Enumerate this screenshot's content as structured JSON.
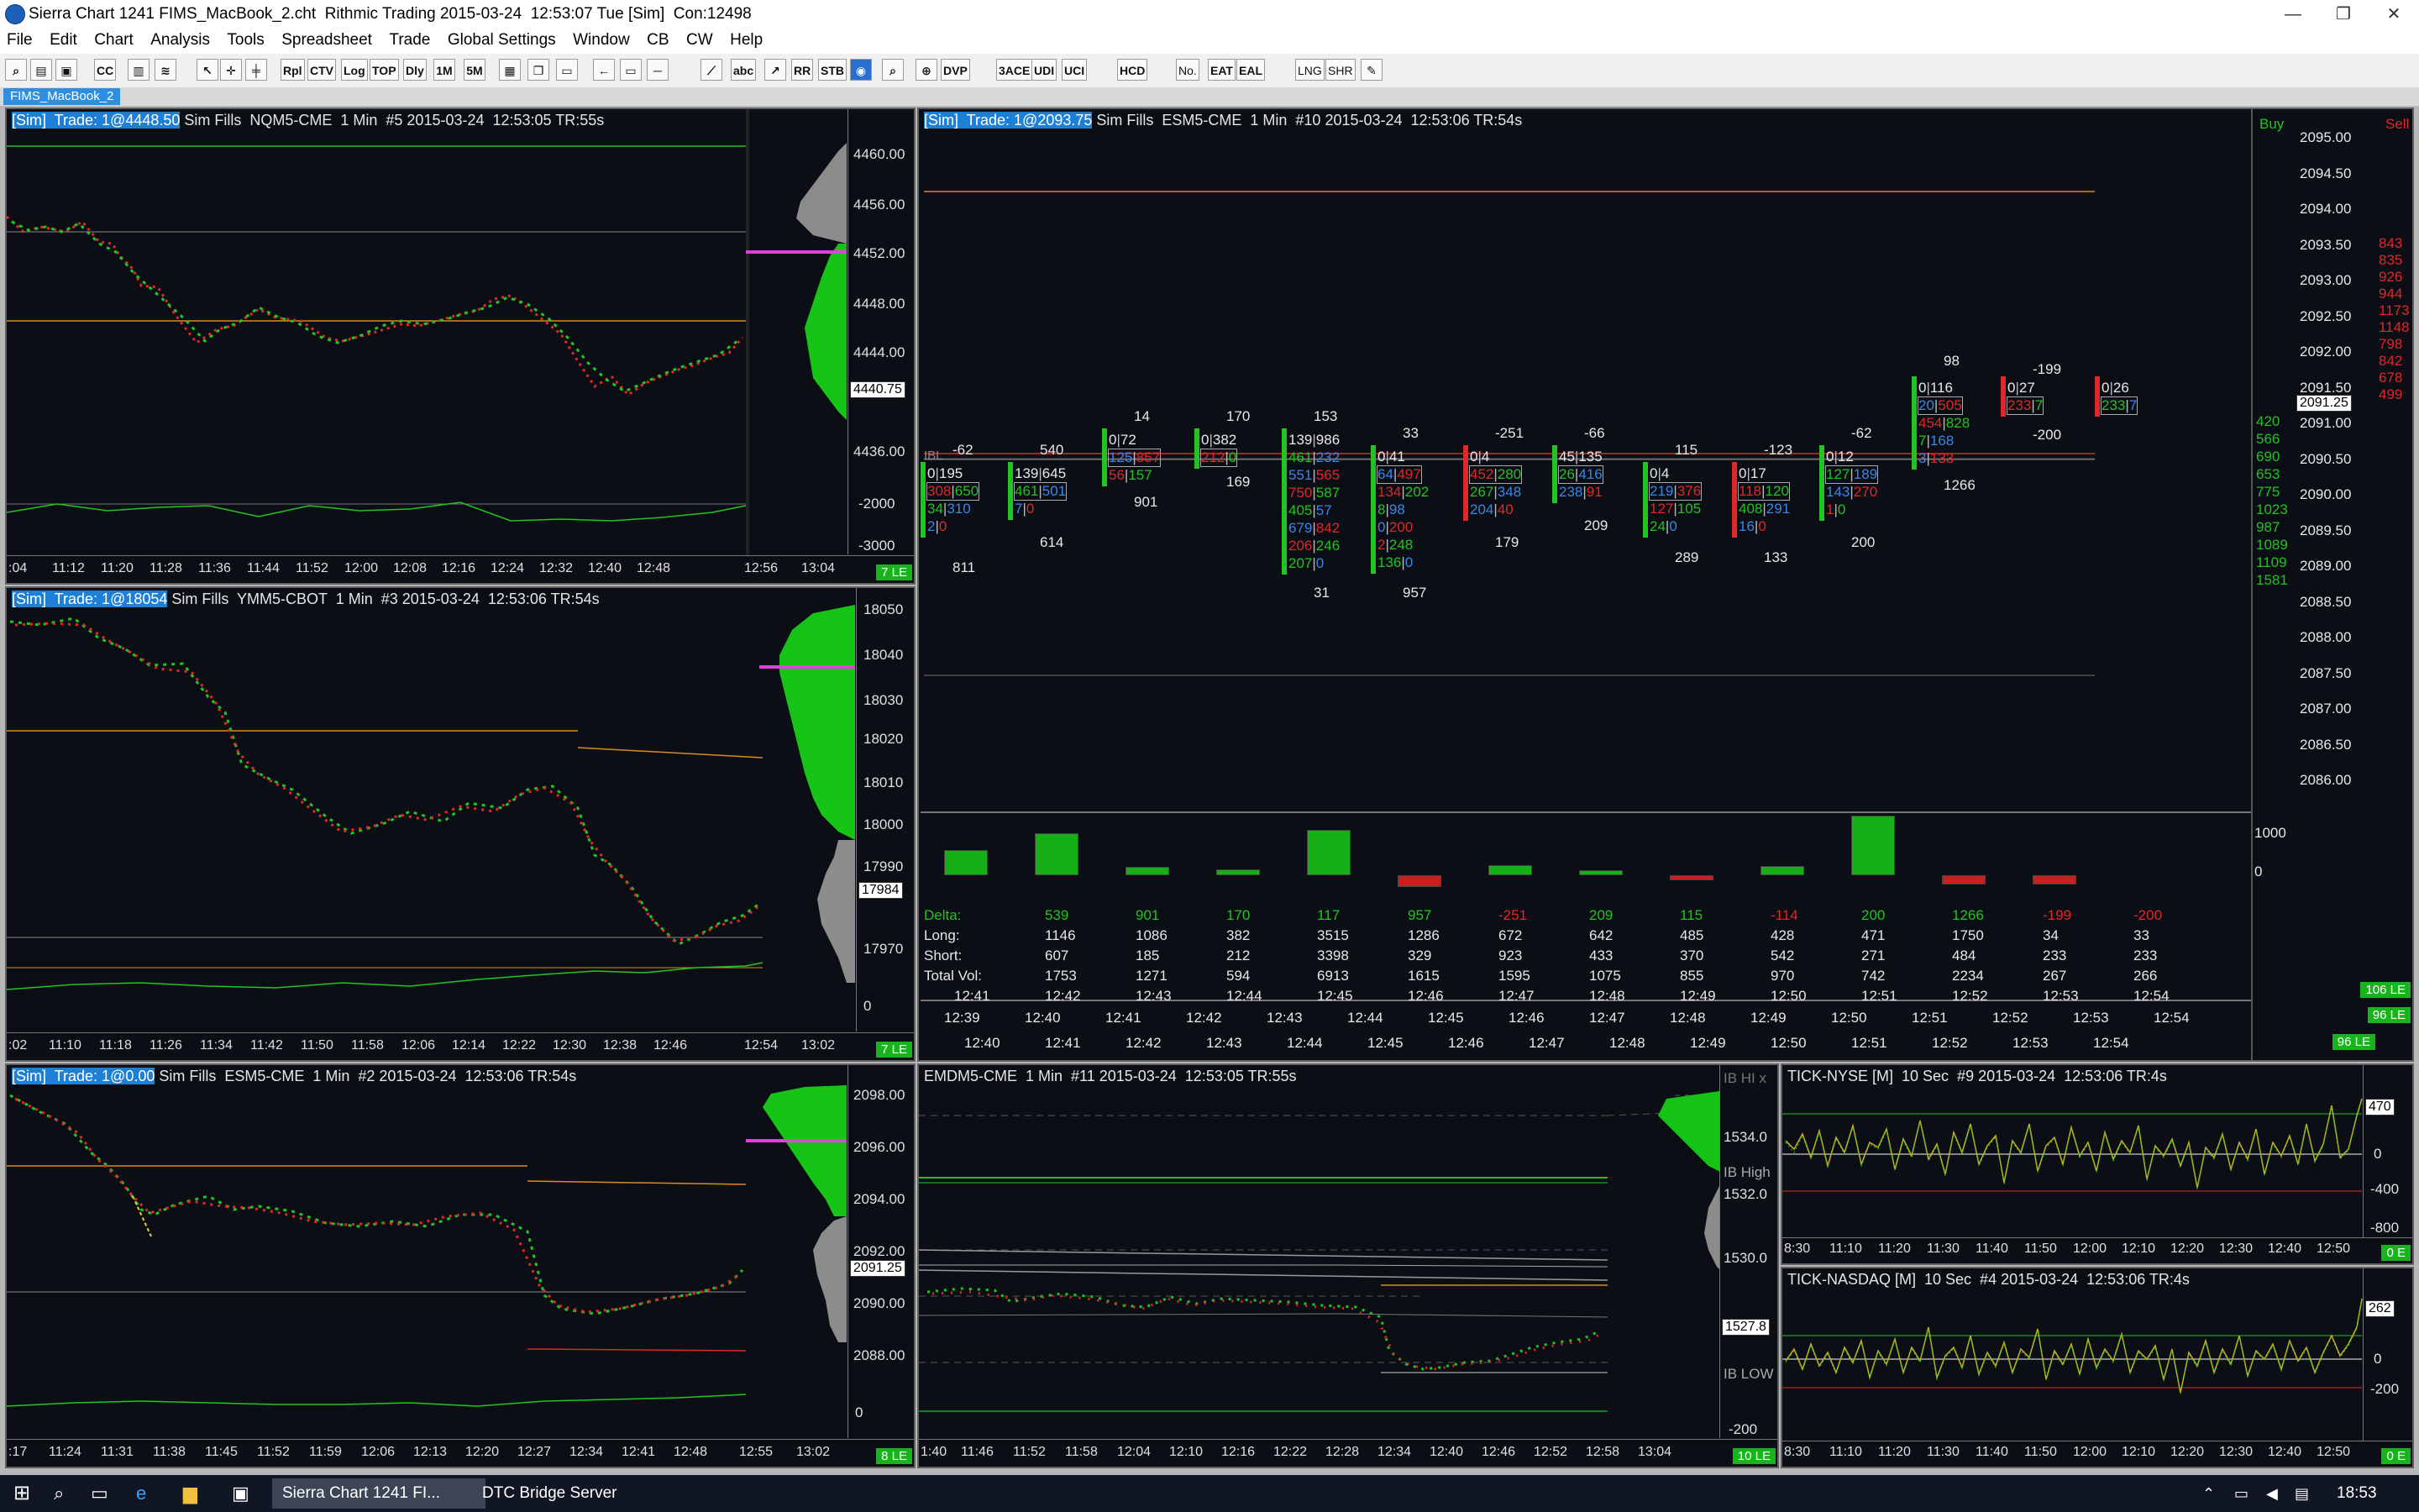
{
  "window": {
    "title": "Sierra Chart 1241 FIMS_MacBook_2.cht  Rithmic Trading 2015-03-24  12:53:07 Tue [Sim]  Con:12498",
    "minimize_glyph": "—",
    "restore_glyph": "❐",
    "close_glyph": "✕"
  },
  "menu": [
    "File",
    "Edit",
    "Chart",
    "Analysis",
    "Tools",
    "Spreadsheet",
    "Trade",
    "Global Settings",
    "Window",
    "CB",
    "CW",
    "Help"
  ],
  "toolbar": [
    "Rpl",
    "CTV",
    "Log",
    "TOP",
    "Dly",
    "1M",
    "5M",
    "DVP",
    "3ACE",
    "UDI",
    "UCI",
    "HCD",
    "No.",
    "EAT",
    "EAL",
    "LNG",
    "SHR",
    "abc",
    "RR",
    "STB",
    "CC"
  ],
  "chartbook_tab": "FIMS_MacBook_2",
  "chart_nq": {
    "title_hl": "[Sim]  Trade: 1@4448.50",
    "title": " Sim Fills  NQM5-CME  1 Min  #5 2015-03-24  12:53:05 TR:55s",
    "y_labels": [
      "4460.00",
      "4456.00",
      "4452.00",
      "4448.00",
      "4444.00",
      "4436.00",
      "-2000",
      "-3000"
    ],
    "price_box": "4440.75",
    "x_labels": [
      ":04",
      "11:12",
      "11:20",
      "11:28",
      "11:36",
      "11:44",
      "11:52",
      "12:00",
      "12:08",
      "12:16",
      "12:24",
      "12:32",
      "12:40",
      "12:48",
      "12:56",
      "13:04"
    ],
    "le": "7 LE"
  },
  "chart_ym": {
    "title_hl": "[Sim]  Trade: 1@18054",
    "title": " Sim Fills  YMM5-CBOT  1 Min  #3 2015-03-24  12:53:06 TR:54s",
    "y_labels": [
      "18050",
      "18040",
      "18030",
      "18020",
      "18010",
      "18000",
      "17990",
      "17970",
      "0"
    ],
    "price_box": "17984",
    "x_labels": [
      ":02",
      "11:10",
      "11:18",
      "11:26",
      "11:34",
      "11:42",
      "11:50",
      "11:58",
      "12:06",
      "12:14",
      "12:22",
      "12:30",
      "12:38",
      "12:46",
      "12:54",
      "13:02"
    ],
    "le": "7 LE"
  },
  "chart_es": {
    "title_hl": "[Sim]  Trade: 1@0.00",
    "title": " Sim Fills  ESM5-CME  1 Min  #2 2015-03-24  12:53:06 TR:54s",
    "y_labels": [
      "2098.00",
      "2096.00",
      "2094.00",
      "2092.00",
      "2090.00",
      "2088.00",
      "0"
    ],
    "price_box": "2091.25",
    "x_labels": [
      ":17",
      "11:24",
      "11:31",
      "11:38",
      "11:45",
      "11:52",
      "11:59",
      "12:06",
      "12:13",
      "12:20",
      "12:27",
      "12:34",
      "12:41",
      "12:48",
      "12:55",
      "13:02"
    ],
    "le": "8 LE"
  },
  "footprint": {
    "title_hl": "[Sim]  Trade: 1@2093.75",
    "title": " Sim Fills  ESM5-CME  1 Min  #10 2015-03-24  12:53:06 TR:54s",
    "buy_label": "Buy",
    "sell_label": "Sell",
    "ibl_label": "IBL",
    "y_labels": [
      "2095.00",
      "2094.50",
      "2094.00",
      "2093.50",
      "2093.00",
      "2092.50",
      "2092.00",
      "2091.50",
      "2091.00",
      "2090.50",
      "2090.00",
      "2089.50",
      "2089.00",
      "2088.50",
      "2088.00",
      "2087.50",
      "2087.00",
      "2086.50",
      "2086.00"
    ],
    "price_box": "2091.25",
    "sell_column": [
      "843",
      "835",
      "926",
      "944",
      "1173",
      "1148",
      "798",
      "842",
      "678",
      "499"
    ],
    "buy_column": [
      "420",
      "566",
      "690",
      "653",
      "775",
      "1023",
      "987",
      "1089",
      "1109",
      "1581"
    ],
    "delta_axis": [
      "1000",
      "0"
    ],
    "top_labels": [
      "-62",
      "540",
      "14",
      "170",
      "153",
      "33",
      "-251",
      "-66",
      "115",
      "-123",
      "-62",
      "98",
      "-199"
    ],
    "bottom_labels": [
      "811",
      "614",
      "901",
      "169",
      "31",
      "957",
      "179",
      "209",
      "289",
      "133",
      "200",
      "1266",
      "-200"
    ],
    "cells": [
      [
        "0|195",
        "308|650",
        "34|310",
        "2|0"
      ],
      [
        "139|645",
        "461|501",
        "7|0"
      ],
      [
        "0|72",
        "125|857",
        "56|157"
      ],
      [
        "0|382",
        "212|0"
      ],
      [
        "139|986",
        "461|232",
        "551|565",
        "750|587",
        "405|57",
        "679|842",
        "206|246",
        "207|0"
      ],
      [
        "0|41",
        "64|497",
        "134|202",
        "8|98",
        "0|200",
        "2|248",
        "136|0"
      ],
      [
        "0|4",
        "452|280",
        "267|348",
        "204|40"
      ],
      [
        "45|135",
        "26|416",
        "238|91"
      ],
      [
        "0|4",
        "219|376",
        "127|105",
        "24|0"
      ],
      [
        "0|17",
        "118|120",
        "408|291",
        "16|0"
      ],
      [
        "0|12",
        "127|189",
        "143|270",
        "1|0"
      ],
      [
        "0|116",
        "20|505",
        "454|828",
        "7|168",
        "3|133"
      ],
      [
        "0|27",
        "233|7"
      ],
      [
        "0|26",
        "233|7"
      ]
    ],
    "stats": {
      "row_labels": [
        "Delta:",
        "Long:",
        "Short:",
        "Total Vol:"
      ],
      "delta": [
        "539",
        "901",
        "170",
        "117",
        "957",
        "-251",
        "209",
        "115",
        "-114",
        "200",
        "1266",
        "-199",
        "-200"
      ],
      "long": [
        "1146",
        "1086",
        "382",
        "3515",
        "1286",
        "672",
        "642",
        "485",
        "428",
        "471",
        "1750",
        "34",
        "33"
      ],
      "short": [
        "607",
        "185",
        "212",
        "3398",
        "329",
        "923",
        "433",
        "370",
        "542",
        "271",
        "484",
        "233",
        "233"
      ],
      "total": [
        "1753",
        "1271",
        "594",
        "6913",
        "1615",
        "1595",
        "1075",
        "855",
        "970",
        "742",
        "2234",
        "267",
        "266"
      ],
      "times": [
        "12:41",
        "12:42",
        "12:43",
        "12:44",
        "12:45",
        "12:46",
        "12:47",
        "12:48",
        "12:49",
        "12:50",
        "12:51",
        "12:52",
        "12:53",
        "12:54"
      ]
    },
    "x_row1": [
      "12:39",
      "12:40",
      "12:41",
      "12:42",
      "12:43",
      "12:44",
      "12:45",
      "12:46",
      "12:47",
      "12:48",
      "12:49",
      "12:50",
      "12:51",
      "12:52",
      "12:53",
      "12:54"
    ],
    "x_row2": [
      "12:40",
      "12:41",
      "12:42",
      "12:43",
      "12:44",
      "12:45",
      "12:46",
      "12:47",
      "12:48",
      "12:49",
      "12:50",
      "12:51",
      "12:52",
      "12:53",
      "12:54"
    ],
    "le1": "106 LE",
    "le2": "96 LE",
    "le3": "96 LE"
  },
  "chart_emd": {
    "title": "EMDM5-CME  1 Min  #11 2015-03-24  12:53:05 TR:55s",
    "y_labels": [
      "IB HI x",
      "1534.0",
      "IB High",
      "1532.0",
      "1530.0",
      "IB LOW",
      "-200"
    ],
    "price_box": "1527.8",
    "x_labels": [
      "1:40",
      "11:46",
      "11:52",
      "11:58",
      "12:04",
      "12:10",
      "12:16",
      "12:22",
      "12:28",
      "12:34",
      "12:40",
      "12:46",
      "12:52",
      "12:58",
      "13:04"
    ],
    "le": "10 LE"
  },
  "tick_nyse": {
    "title": "TICK-NYSE [M]  10 Sec  #9 2015-03-24  12:53:06 TR:4s",
    "y_labels": [
      "0",
      "-400",
      "-800"
    ],
    "price_box": "470",
    "x_labels": [
      "8:30",
      "11:10",
      "11:20",
      "11:30",
      "11:40",
      "11:50",
      "12:00",
      "12:10",
      "12:20",
      "12:30",
      "12:40",
      "12:50"
    ],
    "le": "0 E"
  },
  "tick_nasdaq": {
    "title": "TICK-NASDAQ [M]  10 Sec  #4 2015-03-24  12:53:06 TR:4s",
    "y_labels": [
      "0",
      "-200"
    ],
    "price_box": "262",
    "x_labels": [
      "8:30",
      "11:10",
      "11:20",
      "11:30",
      "11:40",
      "11:50",
      "12:00",
      "12:10",
      "12:20",
      "12:30",
      "12:40",
      "12:50"
    ],
    "le": "0 E"
  },
  "taskbar": {
    "apps": [
      "Sierra Chart 1241 FI...",
      "DTC Bridge Server"
    ],
    "clock": "18:53"
  },
  "colors": {
    "up": "#22c322",
    "down": "#e02828",
    "profile_green": "#16c416",
    "profile_gray": "#8c8c8c",
    "poc": "#e040e0",
    "highlight": "#1d7fd6"
  }
}
